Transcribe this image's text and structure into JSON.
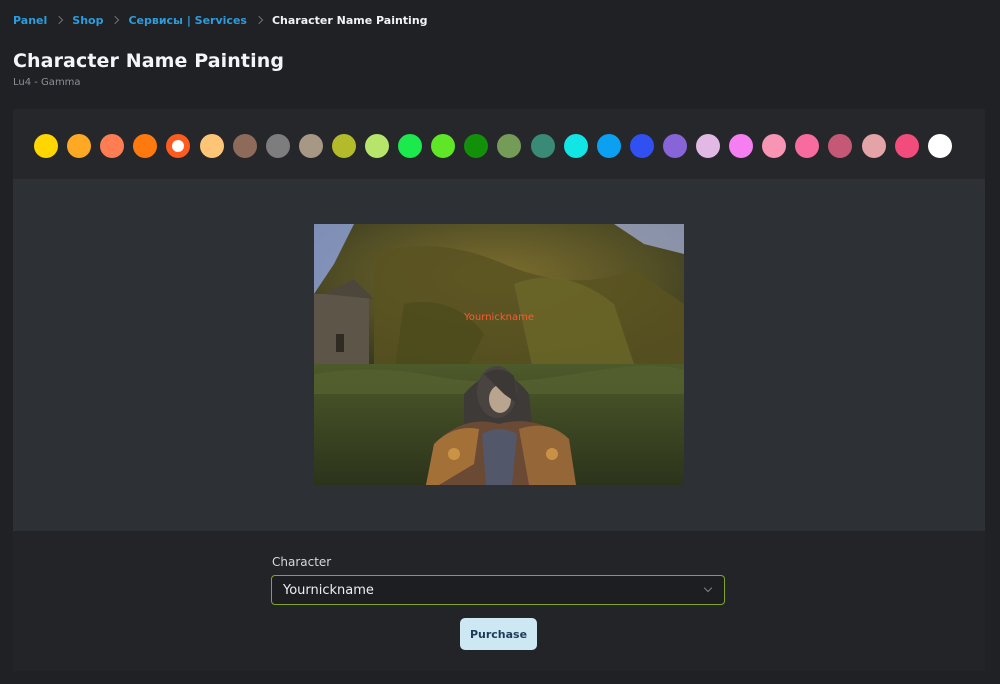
{
  "breadcrumb": {
    "items": [
      "Panel",
      "Shop",
      "Сервисы | Services"
    ],
    "current": "Character Name Painting"
  },
  "header": {
    "title": "Character Name Painting",
    "subtitle": "Lu4 - Gamma"
  },
  "palette": {
    "selected_index": 4,
    "colors": [
      "#ffd600",
      "#ffa823",
      "#ff7d52",
      "#ff7a0e",
      "#ff5a1f",
      "#ffc576",
      "#8d6a5a",
      "#7d7d7d",
      "#a79785",
      "#b4bb2a",
      "#b7e56b",
      "#1ce94c",
      "#5ee627",
      "#13900a",
      "#749b58",
      "#3a8a78",
      "#12e5e5",
      "#0ba0f2",
      "#3050f2",
      "#8765d8",
      "#e2b9e5",
      "#f57ef0",
      "#f995b4",
      "#f76b9f",
      "#c65877",
      "#e4a3a7",
      "#f24c7c",
      "#ffffff"
    ]
  },
  "preview": {
    "nickname": "Yournickname",
    "name_color": "#ff5a2c"
  },
  "form": {
    "character_label": "Character",
    "character_value": "Yournickname",
    "purchase_label": "Purchase"
  },
  "theme": {
    "accent_link": "#2e9cdb",
    "select_border": "#7fa62a",
    "button_bg": "#cde7f3"
  }
}
